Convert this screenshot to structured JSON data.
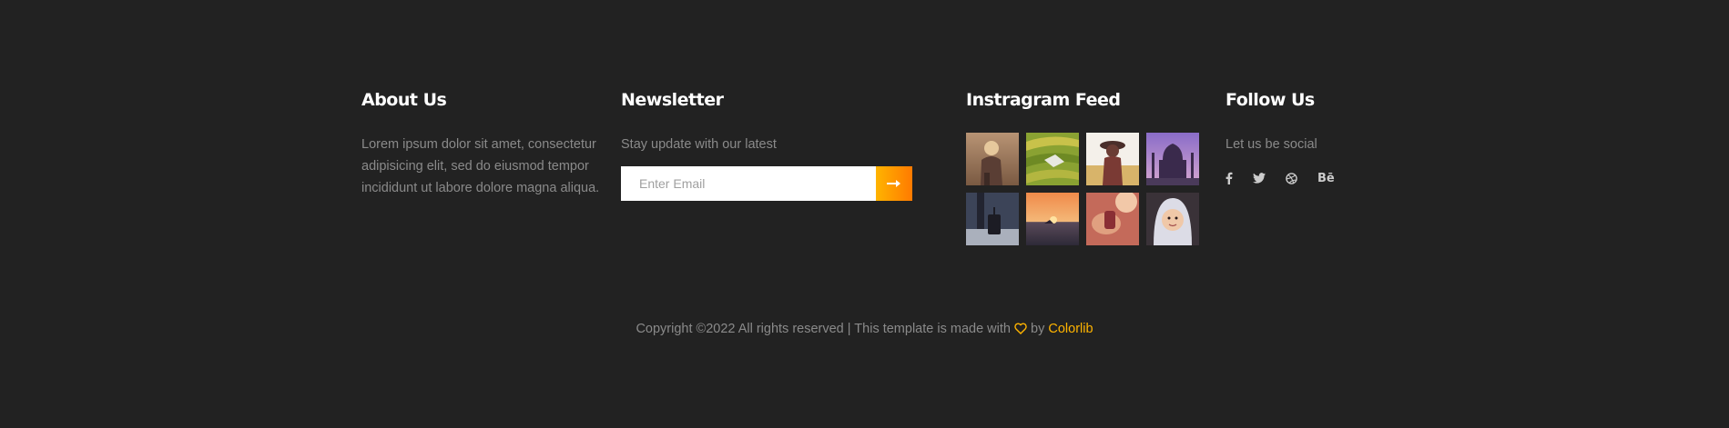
{
  "about": {
    "title": "About Us",
    "text": "Lorem ipsum dolor sit amet, consectetur adipisicing elit, sed do eiusmod tempor incididunt ut labore dolore magna aliqua."
  },
  "newsletter": {
    "title": "Newsletter",
    "text": "Stay update with our latest",
    "email_placeholder": "Enter Email",
    "submit_icon": "arrow-right-icon"
  },
  "instagram": {
    "title": "Instragram Feed",
    "images": [
      "photo-child-in-field",
      "photo-rice-terraces",
      "photo-girl-with-hat",
      "photo-taj-mahal",
      "photo-traveler-with-suitcase",
      "photo-sunset-sea",
      "photo-hands-with-drink",
      "photo-child-in-white-hood"
    ]
  },
  "follow": {
    "title": "Follow Us",
    "text": "Let us be social",
    "icons": [
      "facebook-icon",
      "twitter-icon",
      "dribbble-icon",
      "behance-icon"
    ],
    "behance_text": "Bē"
  },
  "copyright": {
    "text": "Copyright ©2022 All rights reserved | This template is made with",
    "by": "by",
    "brand": "Colorlib"
  },
  "colors": {
    "background": "#222222",
    "accent": "#ffb400",
    "accent_end": "#ff7a00",
    "muted_text": "#8a8a8a"
  }
}
